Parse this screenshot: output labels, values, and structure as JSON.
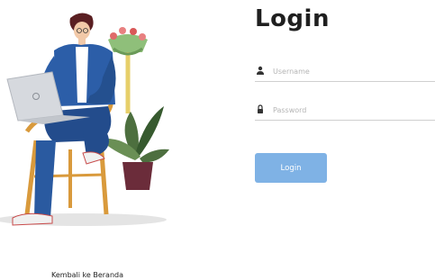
{
  "title": "Login",
  "form": {
    "username_placeholder": "Username",
    "password_placeholder": "Password",
    "username_value": "",
    "password_value": "",
    "submit_label": "Login"
  },
  "back_link_label": "Kembali ke Beranda",
  "colors": {
    "button": "#7fb2e5",
    "title": "#1f1f1f",
    "field_line": "#cfcfcf",
    "placeholder": "#b5b5b5"
  },
  "icons": {
    "username": "user-icon",
    "password": "lock-icon"
  }
}
